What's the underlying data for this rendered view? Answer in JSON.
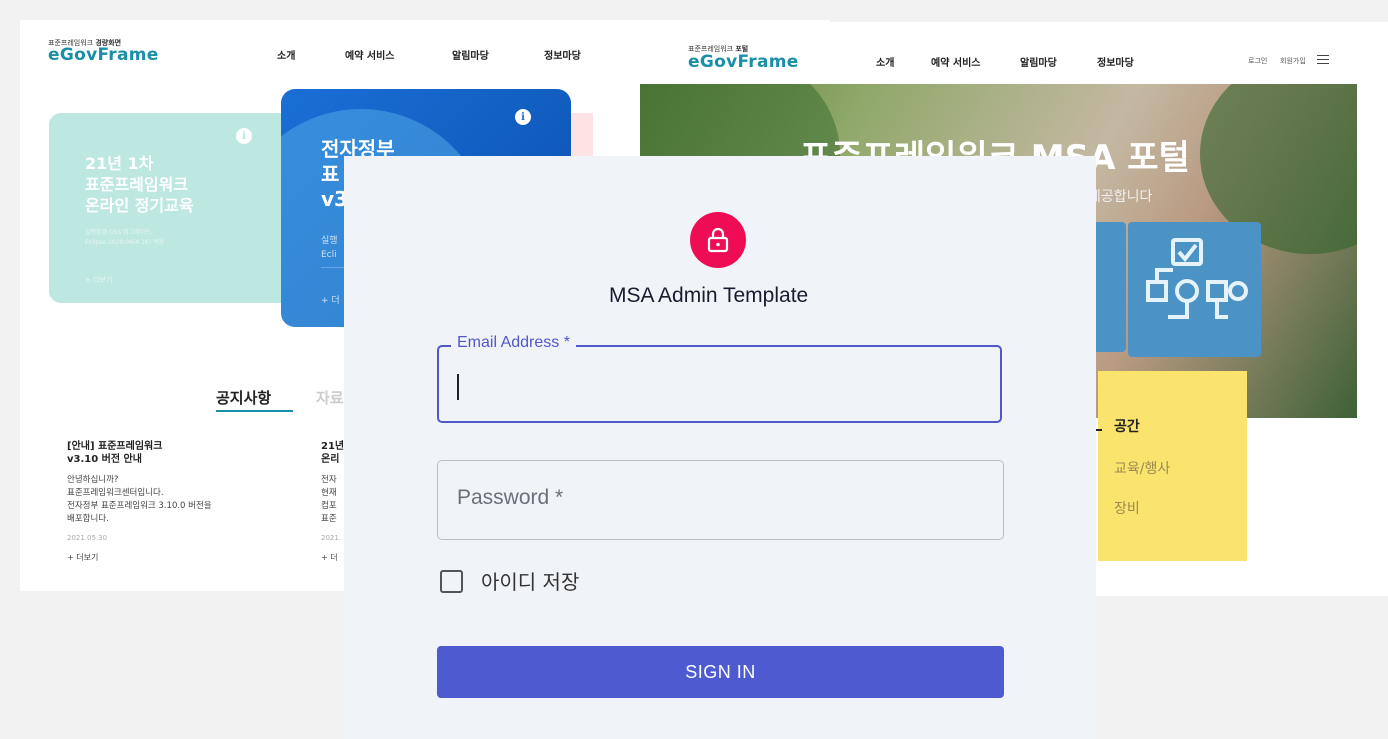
{
  "left_site": {
    "logo_small_prefix": "표준프레임워크",
    "logo_small_bold": "경량화면",
    "logo_main": "eGovFrame",
    "nav": [
      "소개",
      "예약 서비스",
      "알림마당",
      "정보마당"
    ],
    "card1": {
      "title_lines": [
        "21년 1차",
        "표준프레임워크",
        "온라인 정기교육"
      ],
      "sub_lines": [
        "실행환경 OSS 업그레이드,",
        "Eclipse 2020-06(4.16) 적용"
      ],
      "more": "+ 더보기"
    },
    "card2": {
      "title_lines": [
        "전자정부",
        "표",
        "v3"
      ],
      "sub_lines": [
        "실행",
        "Ecli"
      ],
      "more": "+ 더"
    },
    "tabs": {
      "active": "공지사항",
      "inactive": "자료"
    },
    "notices": [
      {
        "title_lines": [
          "[안내] 표준프레임워크",
          "v3.10 버전 안내"
        ],
        "body_lines": [
          "안녕하십니까?",
          "표준프레임워크센터입니다.",
          "전자정부 표준프레임워크 3.10.0 버전을",
          "배포합니다."
        ],
        "date": "2021.05.30",
        "more": "+ 더보기"
      },
      {
        "title_lines": [
          "21년",
          "온리"
        ],
        "body_lines": [
          "전자",
          "현재",
          "컴포",
          "표준"
        ],
        "date": "2021.",
        "more": "+ 더"
      }
    ]
  },
  "right_site": {
    "logo_small_prefix": "표준프레임워크",
    "logo_small_bold": "포털",
    "logo_main": "eGovFrame",
    "nav": [
      "소개",
      "예약 서비스",
      "알림마당",
      "정보마당"
    ],
    "login_link": "로그인",
    "signup_link": "회원가입",
    "hero_title": "표준프레임워크 MSA 포털",
    "hero_sub": "제공합니다",
    "yellow_items": [
      "공간",
      "교육/행사",
      "장비"
    ]
  },
  "login": {
    "title": "MSA Admin Template",
    "email_label": "Email Address *",
    "password_placeholder": "Password *",
    "remember_label": "아이디 저장",
    "signin_label": "SIGN IN",
    "colors": {
      "lock": "#ee0d55",
      "primary": "#4e5bd0",
      "field_focus": "#5058c8"
    }
  }
}
